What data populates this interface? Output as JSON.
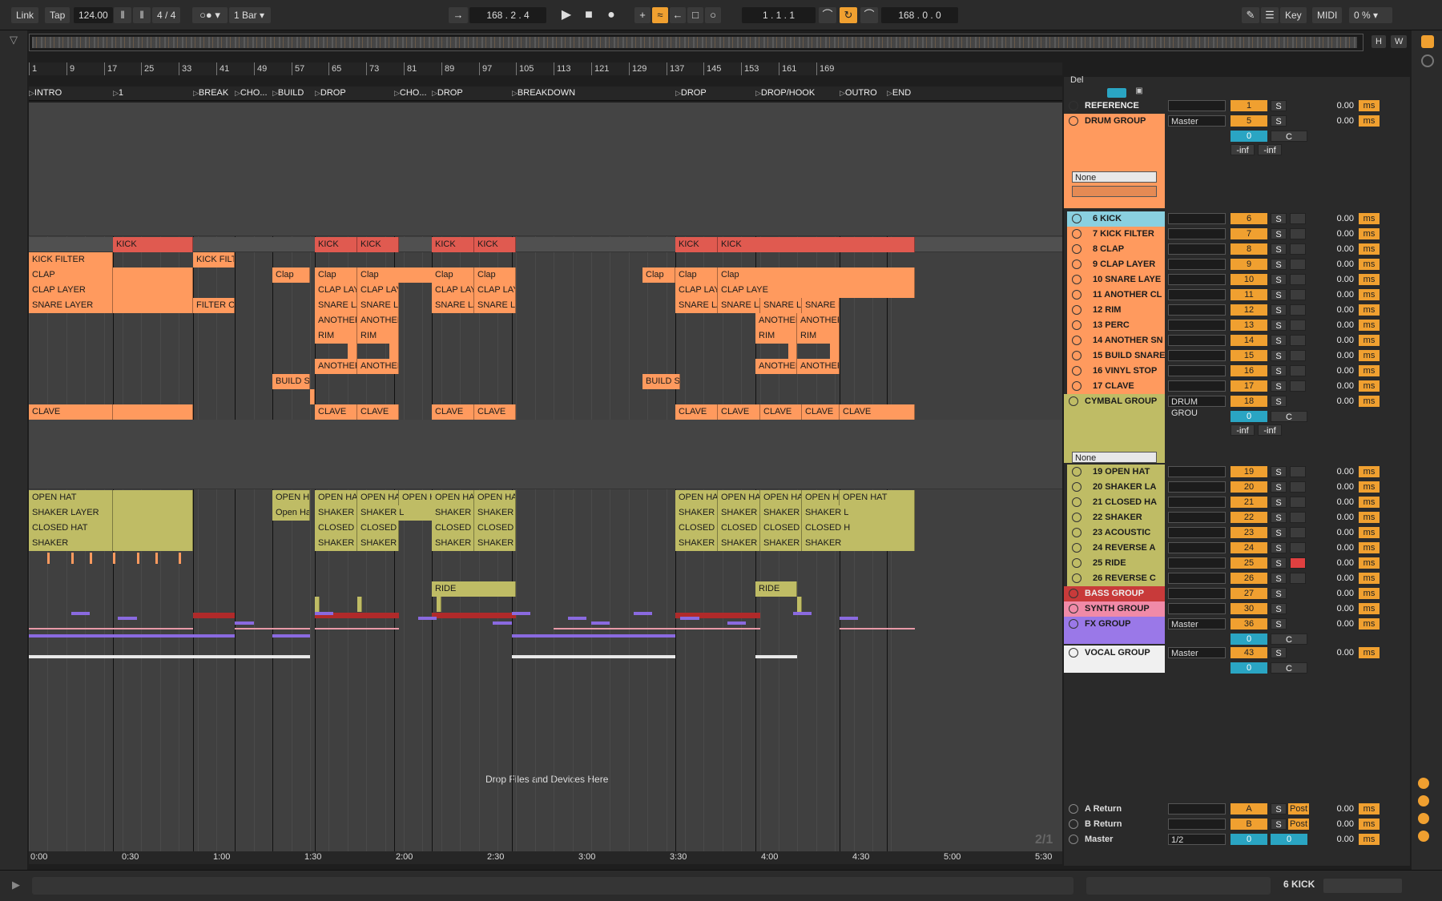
{
  "transport": {
    "link": "Link",
    "tap": "Tap",
    "tempo": "124.00",
    "signature": "4 / 4",
    "quantize": "1 Bar",
    "arr_position": "168 .  2 .  4",
    "loop_start": "1 .  1 .  1",
    "loop_length": "168 .  0 .  0",
    "key": "Key",
    "midi": "MIDI",
    "cpu": "0 %",
    "h_btn": "H",
    "w_btn": "W"
  },
  "ruler": {
    "bars": [
      "1",
      "9",
      "17",
      "25",
      "33",
      "41",
      "49",
      "57",
      "65",
      "73",
      "81",
      "89",
      "97",
      "105",
      "113",
      "121",
      "129",
      "137",
      "145",
      "153",
      "161",
      "169"
    ]
  },
  "locators": [
    "INTRO",
    "1",
    "BREAK",
    "CHO...",
    "BUILD",
    "DROP",
    "CHO...",
    "DROP",
    "BREAKDOWN",
    "DROP",
    "DROP/HOOK",
    "OUTRO",
    "END"
  ],
  "time_ruler": [
    "0:00",
    "0:30",
    "1:00",
    "1:30",
    "2:00",
    "2:30",
    "3:00",
    "3:30",
    "4:00",
    "4:30",
    "5:00",
    "5:30"
  ],
  "drop_hint": "Drop Files and Devices Here",
  "page_counter": "2/1",
  "colors": {
    "red": "#e05a50",
    "orange": "#ff9a5e",
    "yellow": "#bfbc65",
    "accent": "#f0a030",
    "blue": "#2aa5c3"
  },
  "clips": {
    "kick": "KICK",
    "kick_filter": "KICK FILTER",
    "kick_filter_short": "KICK FILTE",
    "clap": "CLAP",
    "clap_short": "Clap",
    "clap_layer": "CLAP LAYER",
    "clap_layer_short": "CLAP LAYE",
    "snare_layer": "SNARE LAYER",
    "snare_layer_short": "SNARE LAYE",
    "filter_out": "FILTER OU",
    "another": "ANOTHER",
    "another_short": "ANOTHER",
    "rim": "RIM",
    "build_snare": "BUILD SN",
    "clave": "CLAVE",
    "open_hat": "OPEN HAT",
    "open_hat_lower": "Open Ha",
    "shaker_layer": "SHAKER LAYER",
    "shaker_layer_short": "SHAKER L",
    "closed_hat": "CLOSED HAT",
    "closed_hat_short": "CLOSED H",
    "shaker": "SHAKER",
    "ride": "RIDE"
  },
  "mixer": {
    "del": "Del",
    "sends": {
      "none": "None",
      "inf": "-inf"
    },
    "tracks": [
      {
        "name": "REFERENCE",
        "io": "",
        "num": "1",
        "solo": "S",
        "delay": "0.00",
        "unit": "ms"
      },
      {
        "name": "DRUM GROUP",
        "io": "Master",
        "num": "5",
        "solo": "S",
        "delay": "0.00",
        "unit": "ms",
        "pan": "0",
        "c": "C"
      },
      {
        "name": "6 KICK",
        "num": "6"
      },
      {
        "name": "7 KICK FILTER",
        "num": "7"
      },
      {
        "name": "8 CLAP",
        "num": "8"
      },
      {
        "name": "9 CLAP LAYER",
        "num": "9"
      },
      {
        "name": "10 SNARE LAYE",
        "num": "10"
      },
      {
        "name": "11 ANOTHER CL",
        "num": "11"
      },
      {
        "name": "12 RIM",
        "num": "12"
      },
      {
        "name": "13 PERC",
        "num": "13"
      },
      {
        "name": "14 ANOTHER SN",
        "num": "14"
      },
      {
        "name": "15 BUILD SNARE",
        "num": "15"
      },
      {
        "name": "16 VINYL STOP",
        "num": "16"
      },
      {
        "name": "17 CLAVE",
        "num": "17"
      },
      {
        "name": "CYMBAL GROUP",
        "io": "DRUM GROU",
        "num": "18",
        "pan": "0",
        "c": "C"
      },
      {
        "name": "19 OPEN HAT",
        "num": "19"
      },
      {
        "name": "20 SHAKER LA",
        "num": "20"
      },
      {
        "name": "21 CLOSED HA",
        "num": "21"
      },
      {
        "name": "22 SHAKER",
        "num": "22"
      },
      {
        "name": "23 ACOUSTIC",
        "num": "23"
      },
      {
        "name": "24 REVERSE A",
        "num": "24"
      },
      {
        "name": "25 RIDE",
        "num": "25"
      },
      {
        "name": "26 REVERSE C",
        "num": "26"
      },
      {
        "name": "BASS GROUP",
        "num": "27"
      },
      {
        "name": "SYNTH GROUP",
        "num": "30"
      },
      {
        "name": "FX GROUP",
        "io": "Master",
        "num": "36",
        "pan": "0",
        "c": "C"
      },
      {
        "name": "VOCAL GROUP",
        "io": "Master",
        "num": "43",
        "pan": "0",
        "c": "C"
      }
    ],
    "returns": [
      {
        "name": "A Return",
        "num": "A",
        "post": "Post"
      },
      {
        "name": "B Return",
        "num": "B",
        "post": "Post"
      },
      {
        "name": "Master",
        "num": "0",
        "io": "1/2"
      }
    ],
    "delay": "0.00",
    "unit": "ms",
    "solo": "S"
  },
  "status": {
    "selected_track": "6 KICK"
  }
}
